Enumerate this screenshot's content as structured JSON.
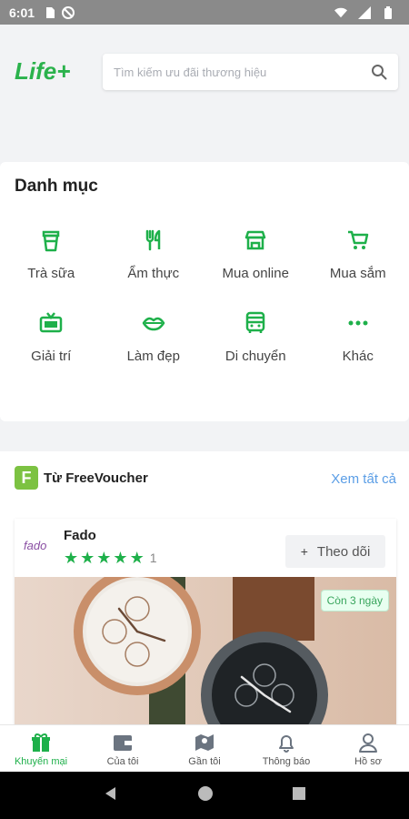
{
  "status_bar": {
    "time": "6:01"
  },
  "header": {
    "logo_text": "Life+",
    "search_placeholder": "Tìm kiếm ưu đãi thương hiệu"
  },
  "categories": {
    "title": "Danh mục",
    "items": [
      {
        "label": "Trà sữa",
        "icon": "cup-icon"
      },
      {
        "label": "Ẩm thực",
        "icon": "fork-knife-icon"
      },
      {
        "label": "Mua online",
        "icon": "store-icon"
      },
      {
        "label": "Mua sắm",
        "icon": "cart-icon"
      },
      {
        "label": "Giải trí",
        "icon": "tv-icon"
      },
      {
        "label": "Làm đẹp",
        "icon": "lips-icon"
      },
      {
        "label": "Di chuyển",
        "icon": "bus-icon"
      },
      {
        "label": "Khác",
        "icon": "more-icon"
      }
    ]
  },
  "freevoucher": {
    "logo_letter": "F",
    "title": "Từ FreeVoucher",
    "see_all": "Xem tất cả",
    "shop": {
      "logo_text": "fado",
      "name": "Fado",
      "stars": 5,
      "rating_count": "1",
      "follow_label": "Theo dõi",
      "badge": "Còn 3 ngày"
    }
  },
  "bottom_nav": [
    {
      "label": "Khuyến mại",
      "icon": "gift-icon",
      "active": true
    },
    {
      "label": "Của tôi",
      "icon": "wallet-icon",
      "active": false
    },
    {
      "label": "Gần tôi",
      "icon": "map-icon",
      "active": false
    },
    {
      "label": "Thông báo",
      "icon": "bell-icon",
      "active": false
    },
    {
      "label": "Hồ sơ",
      "icon": "user-icon",
      "active": false
    }
  ],
  "colors": {
    "brand_green": "#1eb04a",
    "link_blue": "#5b9ee6"
  }
}
